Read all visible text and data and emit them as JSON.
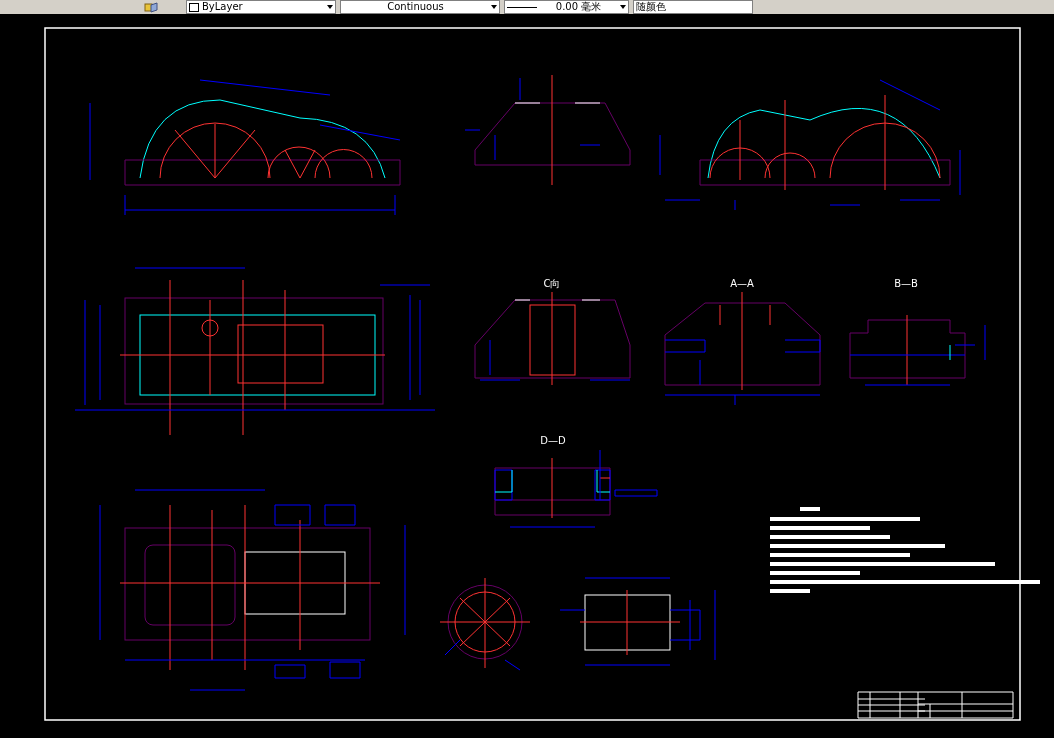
{
  "toolbar": {
    "dropdowns": [
      {
        "kind": "color",
        "value": "ByLayer"
      },
      {
        "kind": "linetype",
        "value": "Continuous"
      },
      {
        "kind": "lineweight",
        "value": "0.00 毫米"
      },
      {
        "kind": "plotstyle",
        "value": "随颜色"
      }
    ]
  },
  "drawing": {
    "view_labels": [
      {
        "text": "C向"
      },
      {
        "text": "A—A"
      },
      {
        "text": "B—B"
      },
      {
        "text": "D—D"
      }
    ]
  }
}
